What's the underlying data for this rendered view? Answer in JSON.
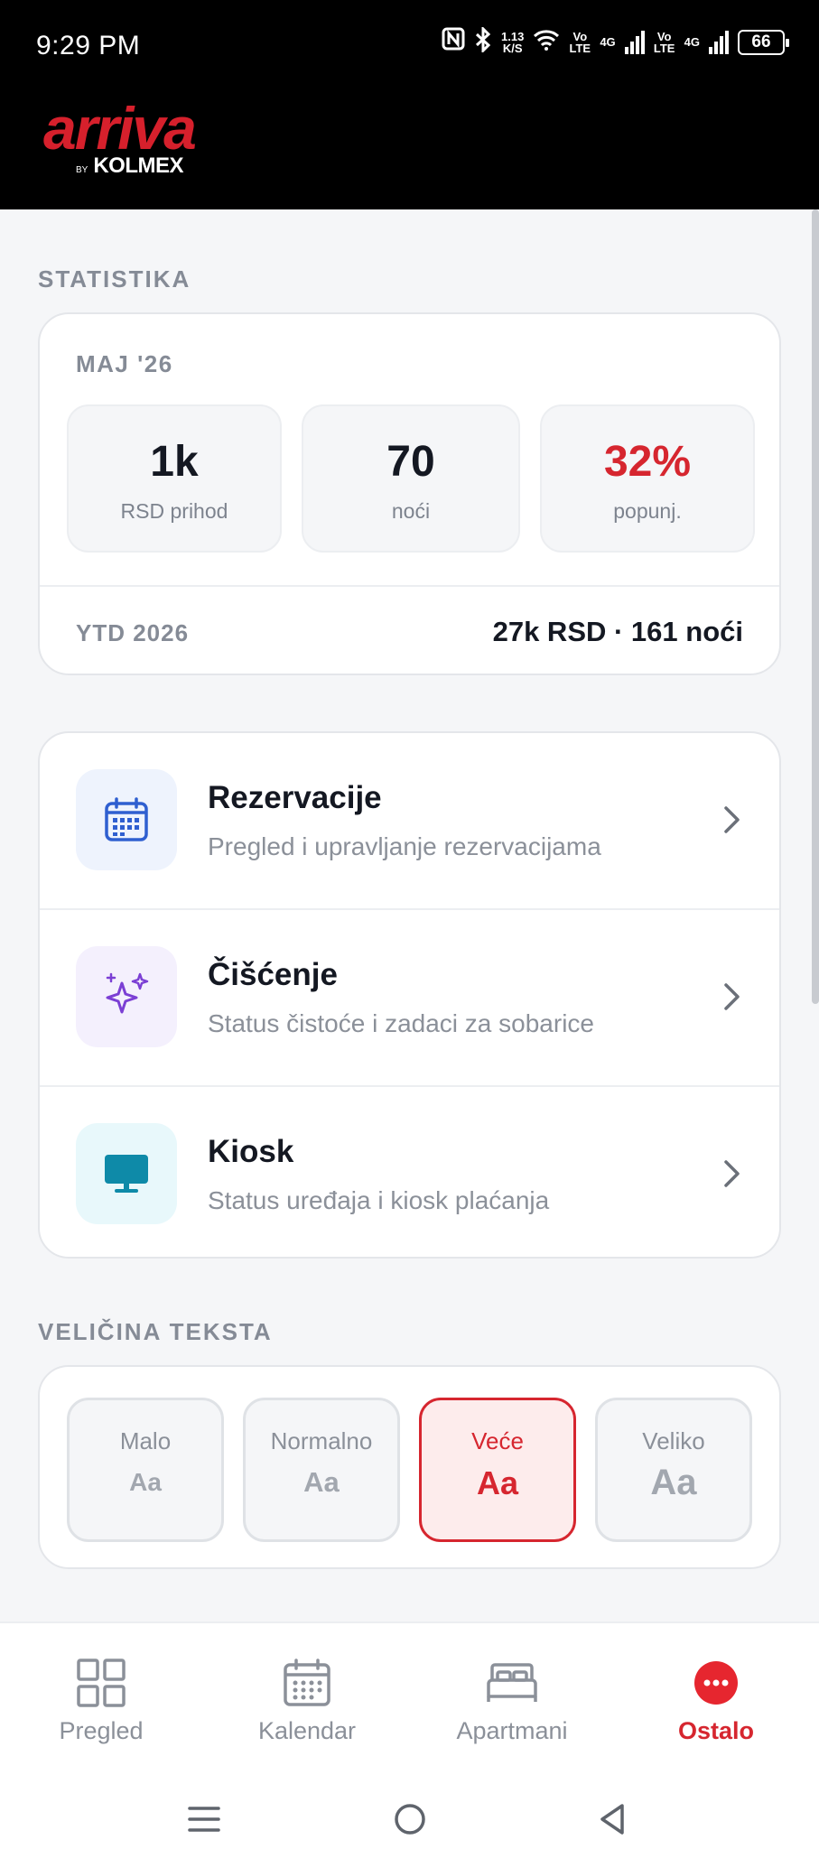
{
  "status_bar": {
    "time": "9:29 PM",
    "speed_value": "1.13",
    "speed_unit": "K/S",
    "volte1": "Vo LTE",
    "net1": "4G",
    "volte2": "Vo LTE",
    "net2": "4G",
    "battery": "66"
  },
  "brand": {
    "name": "arriva",
    "by": "BY",
    "partner": "KOLMEX"
  },
  "stats": {
    "section_label": "STATISTIKA",
    "month_label": "MAJ '26",
    "boxes": [
      {
        "value": "1k",
        "label": "RSD prihod"
      },
      {
        "value": "70",
        "label": "noći"
      },
      {
        "value": "32%",
        "label": "popunj."
      }
    ],
    "ytd_label": "YTD 2026",
    "ytd_value": "27k RSD · 161 noći"
  },
  "menu": [
    {
      "title": "Rezervacije",
      "subtitle": "Pregled i upravljanje rezervacijama",
      "icon": "calendar-icon"
    },
    {
      "title": "Čišćenje",
      "subtitle": "Status čistoće i zadaci za sobarice",
      "icon": "sparkles-icon"
    },
    {
      "title": "Kiosk",
      "subtitle": "Status uređaja i kiosk plaćanja",
      "icon": "monitor-icon"
    }
  ],
  "text_size": {
    "section_label": "VELIČINA TEKSTA",
    "options": [
      {
        "name": "Malo",
        "sample": "Aa"
      },
      {
        "name": "Normalno",
        "sample": "Aa"
      },
      {
        "name": "Veće",
        "sample": "Aa"
      },
      {
        "name": "Veliko",
        "sample": "Aa"
      }
    ],
    "selected": "Veće"
  },
  "bottom_nav": [
    {
      "label": "Pregled",
      "icon": "grid-icon"
    },
    {
      "label": "Kalendar",
      "icon": "calendar-icon"
    },
    {
      "label": "Apartmani",
      "icon": "bed-icon"
    },
    {
      "label": "Ostalo",
      "icon": "more-icon"
    }
  ],
  "colors": {
    "accent": "#d6262f",
    "blue": "#2f5fd0",
    "purple": "#7b3fd4",
    "teal": "#0e8aa8"
  }
}
